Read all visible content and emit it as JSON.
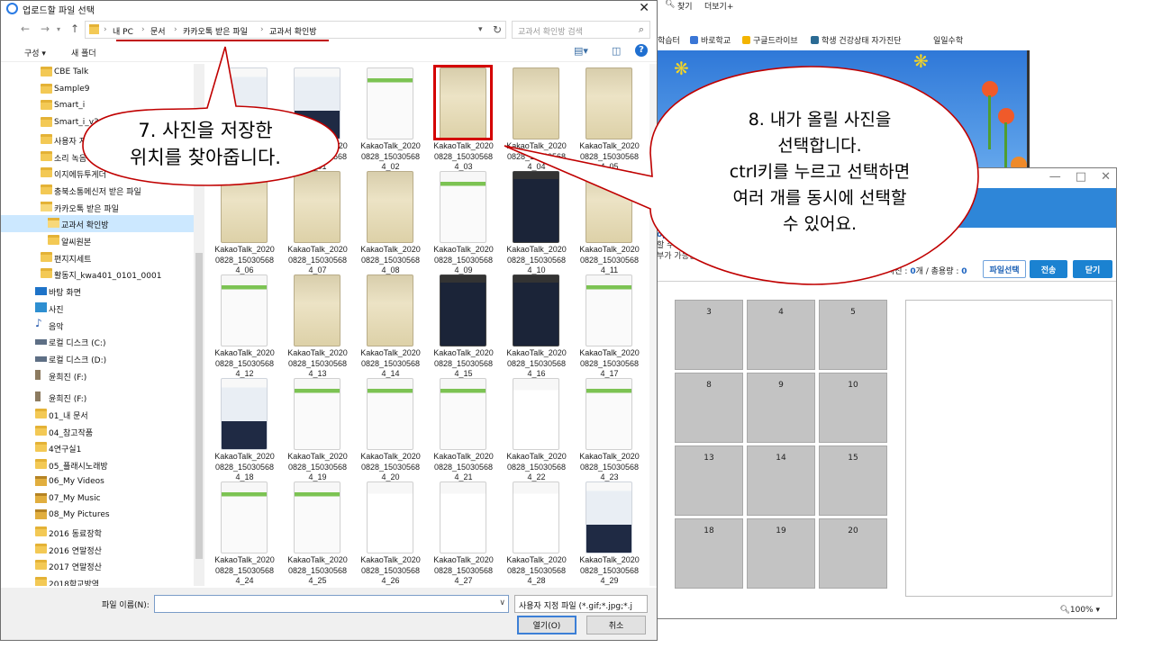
{
  "browser": {
    "toolbar": {
      "find": "찾기",
      "more": "더보기+"
    },
    "favorites": [
      "학습터",
      "바로학교",
      "구글드라이브",
      "학생 건강상태 자가진단",
      "일일수학"
    ],
    "upload_window": {
      "title_controls": [
        "—",
        "□",
        "✕"
      ],
      "text_lines": [
        "op",
        "할 수 있",
        "부가 가능합"
      ],
      "count_text_prefix": "사진 : ",
      "count_value": "0",
      "count_unit": "개 / 총용량 : ",
      "size_value": "0",
      "buttons": {
        "select_file": "파일선택",
        "send": "전송",
        "close": "닫기"
      },
      "grid_numbers": [
        "3",
        "4",
        "5",
        "8",
        "9",
        "10",
        "13",
        "14",
        "15",
        "18",
        "19",
        "20"
      ],
      "zoom": "100%",
      "accent": "#2e86d8"
    }
  },
  "dialog": {
    "title": "업로드할 파일 선택",
    "close_glyph": "✕",
    "breadcrumb": [
      "내 PC",
      "문서",
      "카카오톡 받은 파일",
      "교과서 확인방"
    ],
    "search_placeholder": "교과서 확인방 검색",
    "commands": {
      "organize": "구성 ▾",
      "new_folder": "새 폴더"
    },
    "tree": [
      {
        "label": "CBE Talk",
        "icon": "folder-icon"
      },
      {
        "label": "Sample9",
        "icon": "folder-icon"
      },
      {
        "label": "Smart_i",
        "icon": "folder-icon"
      },
      {
        "label": "Smart_i_v3.2",
        "icon": "folder-icon"
      },
      {
        "label": "사용자 지정",
        "icon": "folder-icon"
      },
      {
        "label": "소리 녹음",
        "icon": "folder-icon"
      },
      {
        "label": "이지에듀투게더",
        "icon": "folder-icon"
      },
      {
        "label": "충북소통메신저 받은 파일",
        "icon": "folder-icon"
      },
      {
        "label": "카카오톡 받은 파일",
        "icon": "folder-open-icon"
      },
      {
        "label": "교과서 확인방",
        "icon": "folder-open-icon",
        "selected": true
      },
      {
        "label": "알씨원본",
        "icon": "folder-icon"
      },
      {
        "label": "편지지세트",
        "icon": "folder-icon"
      },
      {
        "label": "활동지_kwa401_0101_0001",
        "icon": "folder-icon"
      },
      {
        "label": "바탕 화면",
        "icon": "desktop-icon"
      },
      {
        "label": "사진",
        "icon": "pictures-icon"
      },
      {
        "label": "음악",
        "icon": "music-icon"
      },
      {
        "label": "로컬 디스크 (C:)",
        "icon": "drive-icon"
      },
      {
        "label": "로컬 디스크 (D:)",
        "icon": "drive-icon"
      },
      {
        "label": "윤희진 (F:)",
        "icon": "usb-drive-icon"
      },
      {
        "label": "윤희진 (F:)",
        "icon": "usb-drive-icon"
      },
      {
        "label": "01_내 문서",
        "icon": "folder-icon"
      },
      {
        "label": "04_참고작품",
        "icon": "folder-icon"
      },
      {
        "label": "4연구실1",
        "icon": "folder-icon"
      },
      {
        "label": "05_플래시노래방",
        "icon": "folder-icon"
      },
      {
        "label": "06_My Videos",
        "icon": "media-folder-icon"
      },
      {
        "label": "07_My Music",
        "icon": "media-folder-icon"
      },
      {
        "label": "08_My Pictures",
        "icon": "media-folder-icon"
      },
      {
        "label": "2016 동료장학",
        "icon": "folder-icon"
      },
      {
        "label": "2016 연말정산",
        "icon": "folder-icon"
      },
      {
        "label": "2017 연말정산",
        "icon": "folder-icon"
      },
      {
        "label": "2018학교방역",
        "icon": "folder-icon"
      }
    ],
    "files": [
      {
        "label": "",
        "kind": "phone"
      },
      {
        "label": "KakaoTalk_2020 0828_15030568 4_01",
        "kind": "phone"
      },
      {
        "label": "KakaoTalk_2020 0828_15030568 4_02",
        "kind": "form"
      },
      {
        "label": "KakaoTalk_2020 0828_15030568 4_03",
        "kind": "doc",
        "selected": true
      },
      {
        "label": "KakaoTalk_2020 0828_15030568 4_04",
        "kind": "doc"
      },
      {
        "label": "KakaoTalk_2020 0828_15030568 4_05",
        "kind": "doc"
      },
      {
        "label": "KakaoTalk_2020 0828_15030568 4_06",
        "kind": "doc"
      },
      {
        "label": "KakaoTalk_2020 0828_15030568 4_07",
        "kind": "doc"
      },
      {
        "label": "KakaoTalk_2020 0828_15030568 4_08",
        "kind": "doc"
      },
      {
        "label": "KakaoTalk_2020 0828_15030568 4_09",
        "kind": "form"
      },
      {
        "label": "KakaoTalk_2020 0828_15030568 4_10",
        "kind": "dark"
      },
      {
        "label": "KakaoTalk_2020 0828_15030568 4_11",
        "kind": "doc"
      },
      {
        "label": "KakaoTalk_2020 0828_15030568 4_12",
        "kind": "form"
      },
      {
        "label": "KakaoTalk_2020 0828_15030568 4_13",
        "kind": "doc"
      },
      {
        "label": "KakaoTalk_2020 0828_15030568 4_14",
        "kind": "doc"
      },
      {
        "label": "KakaoTalk_2020 0828_15030568 4_15",
        "kind": "dark"
      },
      {
        "label": "KakaoTalk_2020 0828_15030568 4_16",
        "kind": "dark"
      },
      {
        "label": "KakaoTalk_2020 0828_15030568 4_17",
        "kind": "form"
      },
      {
        "label": "KakaoTalk_2020 0828_15030568 4_18",
        "kind": "phone"
      },
      {
        "label": "KakaoTalk_2020 0828_15030568 4_19",
        "kind": "form"
      },
      {
        "label": "KakaoTalk_2020 0828_15030568 4_20",
        "kind": "form"
      },
      {
        "label": "KakaoTalk_2020 0828_15030568 4_21",
        "kind": "form"
      },
      {
        "label": "KakaoTalk_2020 0828_15030568 4_22",
        "kind": "cal"
      },
      {
        "label": "KakaoTalk_2020 0828_15030568 4_23",
        "kind": "form"
      },
      {
        "label": "KakaoTalk_2020 0828_15030568 4_24",
        "kind": "form"
      },
      {
        "label": "KakaoTalk_2020 0828_15030568 4_25",
        "kind": "form"
      },
      {
        "label": "KakaoTalk_2020 0828_15030568 4_26",
        "kind": "cal"
      },
      {
        "label": "KakaoTalk_2020 0828_15030568 4_27",
        "kind": "cal"
      },
      {
        "label": "KakaoTalk_2020 0828_15030568 4_28",
        "kind": "cal"
      },
      {
        "label": "KakaoTalk_2020 0828_15030568 4_29",
        "kind": "phone"
      }
    ],
    "filename_label": "파일 이름(N):",
    "filename_value": "",
    "filetype": "사용자 지정 파일 (*.gif;*.jpg;*.j",
    "open_label": "열기(O)",
    "cancel_label": "취소"
  },
  "callouts": {
    "step7": "7. 사진을 저장한\n위치를 찾아줍니다.",
    "step8": "8. 내가 올릴 사진을\n선택합니다.\nctrl키를 누르고 선택하면\n여러 개를 동시에 선택할\n수 있어요."
  },
  "colors": {
    "highlight_red": "#c00000",
    "tree_selection": "#cce8ff"
  }
}
